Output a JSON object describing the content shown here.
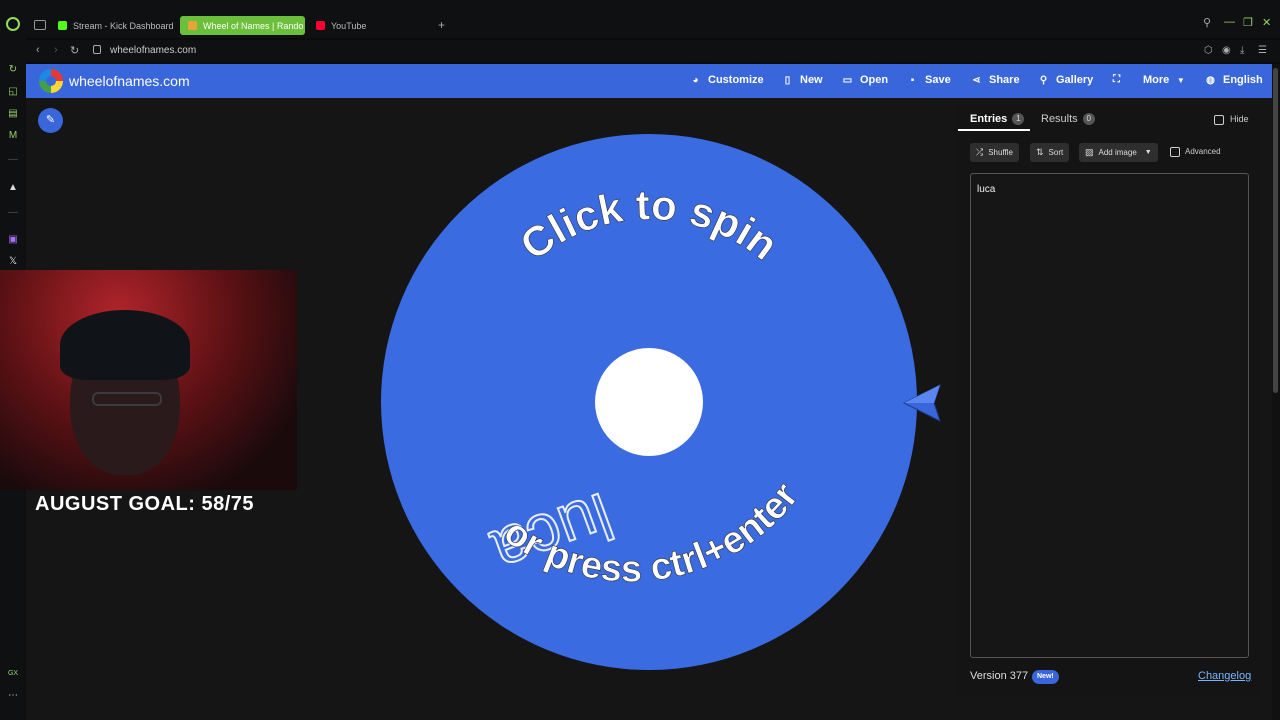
{
  "browser": {
    "tabs": [
      {
        "title": "Stream - Kick Dashboard",
        "favicon_color": "#53fc18"
      },
      {
        "title": "Wheel of Names | Rando",
        "favicon_color": "#e8a33a"
      },
      {
        "title": "YouTube",
        "favicon_color": "#ff0033"
      }
    ],
    "url": "wheelofnames.com",
    "accent": "#6cbf3b"
  },
  "header": {
    "site_title": "wheelofnames.com",
    "buttons": {
      "customize": "Customize",
      "new": "New",
      "open": "Open",
      "save": "Save",
      "share": "Share",
      "gallery": "Gallery",
      "more": "More",
      "language": "English"
    },
    "color": "#3a66db"
  },
  "wheel": {
    "instruction_top": "Click to spin",
    "instruction_bottom": "or press ctrl+enter",
    "segment_label": "luca",
    "segment_color": "#3b6be0"
  },
  "overlay": {
    "goal_text": "AUGUST GOAL: 58/75"
  },
  "panel": {
    "tab_entries": "Entries",
    "entries_count": "1",
    "tab_results": "Results",
    "results_count": "0",
    "hide_label": "Hide",
    "shuffle_label": "Shuffle",
    "sort_label": "Sort",
    "add_image_label": "Add image",
    "advanced_label": "Advanced",
    "entries_text": "luca",
    "version_text": "Version 377",
    "new_badge": "New!",
    "changelog_link": "Changelog"
  }
}
